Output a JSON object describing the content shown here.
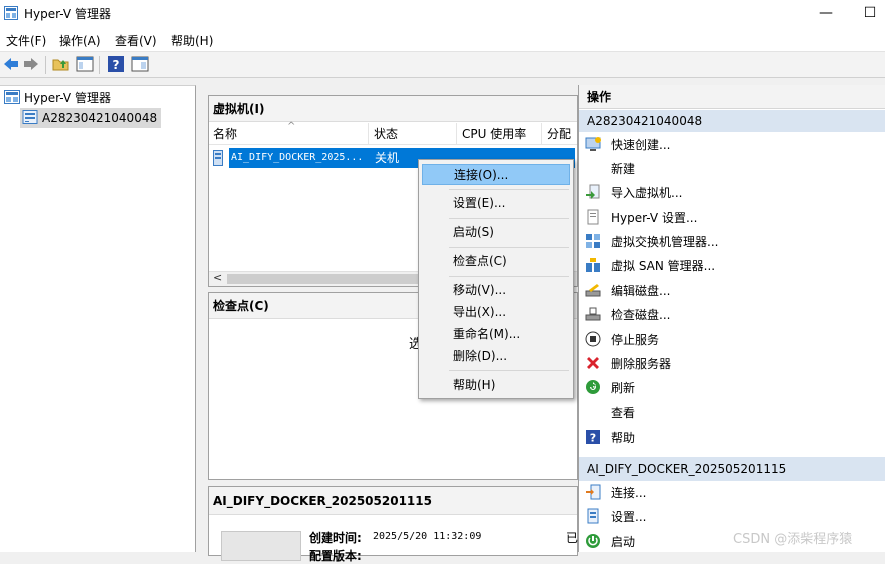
{
  "window": {
    "title": "Hyper-V 管理器",
    "minimize": "—",
    "maximize": "☐"
  },
  "menu": [
    "文件(F)",
    "操作(A)",
    "查看(V)",
    "帮助(H)"
  ],
  "tree": {
    "root": "Hyper-V 管理器",
    "server": "A28230421040048"
  },
  "vm_panel": {
    "title": "虚拟机(I)",
    "columns": [
      "名称",
      "状态",
      "CPU 使用率",
      "分配"
    ],
    "rows": [
      {
        "name": "AI_DIFY_DOCKER_2025...",
        "state": "关机"
      }
    ],
    "scroll_left": "<"
  },
  "checkpoint_panel": {
    "title": "检查点(C)",
    "partial_text": "选"
  },
  "details_panel": {
    "title": "AI_DIFY_DOCKER_202505201115",
    "created_label": "创建时间:",
    "created_value": "2025/5/20 11:32:09",
    "next_label": "配置版本:",
    "cut_char": "已"
  },
  "context_menu": [
    {
      "label": "连接(O)...",
      "highlight": true
    },
    {
      "label": "设置(E)..."
    },
    {
      "label": "启动(S)"
    },
    {
      "label": "检查点(C)"
    },
    {
      "label": "移动(V)..."
    },
    {
      "label": "导出(X)..."
    },
    {
      "label": "重命名(M)..."
    },
    {
      "label": "删除(D)..."
    },
    {
      "label": "帮助(H)"
    }
  ],
  "actions": {
    "title": "操作",
    "server_section": "A28230421040048",
    "server_items": [
      {
        "label": "快速创建...",
        "icon": "quick-create-icon"
      },
      {
        "label": "新建",
        "icon": "none"
      },
      {
        "label": "导入虚拟机...",
        "icon": "import-vm-icon"
      },
      {
        "label": "Hyper-V 设置...",
        "icon": "hyperv-settings-icon"
      },
      {
        "label": "虚拟交换机管理器...",
        "icon": "virtual-switch-icon"
      },
      {
        "label": "虚拟 SAN 管理器...",
        "icon": "virtual-san-icon"
      },
      {
        "label": "编辑磁盘...",
        "icon": "edit-disk-icon"
      },
      {
        "label": "检查磁盘...",
        "icon": "inspect-disk-icon"
      },
      {
        "label": "停止服务",
        "icon": "stop-service-icon"
      },
      {
        "label": "删除服务器",
        "icon": "remove-server-icon"
      },
      {
        "label": "刷新",
        "icon": "refresh-icon"
      },
      {
        "label": "查看",
        "icon": "none"
      },
      {
        "label": "帮助",
        "icon": "help-icon"
      }
    ],
    "vm_section": "AI_DIFY_DOCKER_202505201115",
    "vm_items": [
      {
        "label": "连接...",
        "icon": "connect-icon"
      },
      {
        "label": "设置...",
        "icon": "settings-icon"
      },
      {
        "label": "启动",
        "icon": "start-icon"
      }
    ]
  },
  "watermark": "CSDN @添柴程序猿",
  "colors": {
    "selection": "#0078d7",
    "ctx_highlight": "#91c9f7",
    "section_header": "#d9e4f1"
  }
}
